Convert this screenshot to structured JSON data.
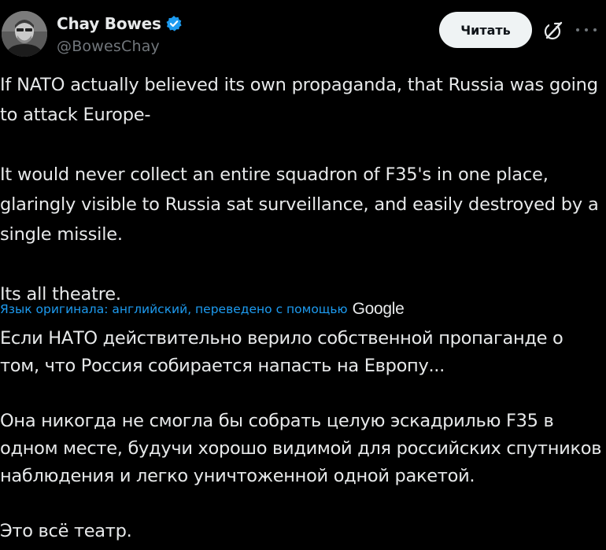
{
  "author": {
    "display_name": "Chay Bowes",
    "handle": "@BowesChay",
    "verified": true,
    "verified_color": "#1d9bf0"
  },
  "actions": {
    "read_label": "Читать",
    "grok_icon": "grok-icon",
    "more_icon": "more-icon"
  },
  "tweet": {
    "paragraphs": [
      "If NATO actually believed its own propaganda, that Russia was going to attack Europe-",
      "It would never collect an entire squadron of F35's in one place, glaringly visible to Russia sat surveillance, and easily destroyed by a single missile.",
      "Its all theatre."
    ]
  },
  "translation": {
    "note": "Язык оригинала: английский, переведено с помощью",
    "provider": "Google",
    "paragraphs": [
      "Если НАТО действительно верило собственной пропаганде о том, что Россия собирается напасть на Европу...",
      "Она никогда не смогла бы собрать целую эскадрилью F35 в одном месте, будучи хорошо видимой для российских спутников наблюдения и легко уничтоженной одной ракетой.",
      "Это всё театр."
    ]
  },
  "colors": {
    "background": "#000000",
    "text": "#e7e9ea",
    "secondary": "#71767b",
    "link": "#1d9bf0"
  }
}
